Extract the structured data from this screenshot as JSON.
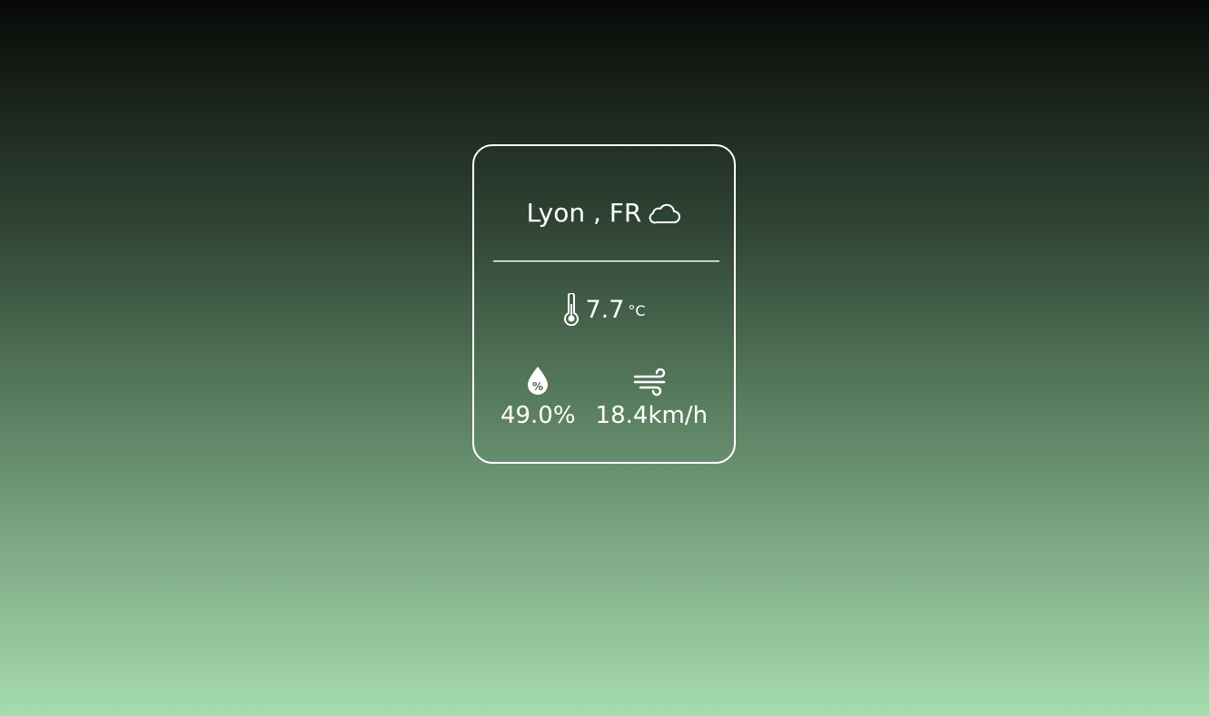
{
  "weather": {
    "city": "Lyon",
    "country": "FR",
    "location_label": "Lyon , FR",
    "condition_icon": "cloud-icon",
    "temperature": "7.7",
    "temperature_unit": "°C",
    "humidity": "49.0%",
    "humidity_icon": "humidity-drop-icon",
    "wind_speed": "18.4km/h",
    "wind_icon": "wind-icon"
  },
  "colors": {
    "text": "#ffffff",
    "card_border": "#ffffff",
    "background_top": "#070907",
    "background_bottom": "#a6dcae"
  }
}
